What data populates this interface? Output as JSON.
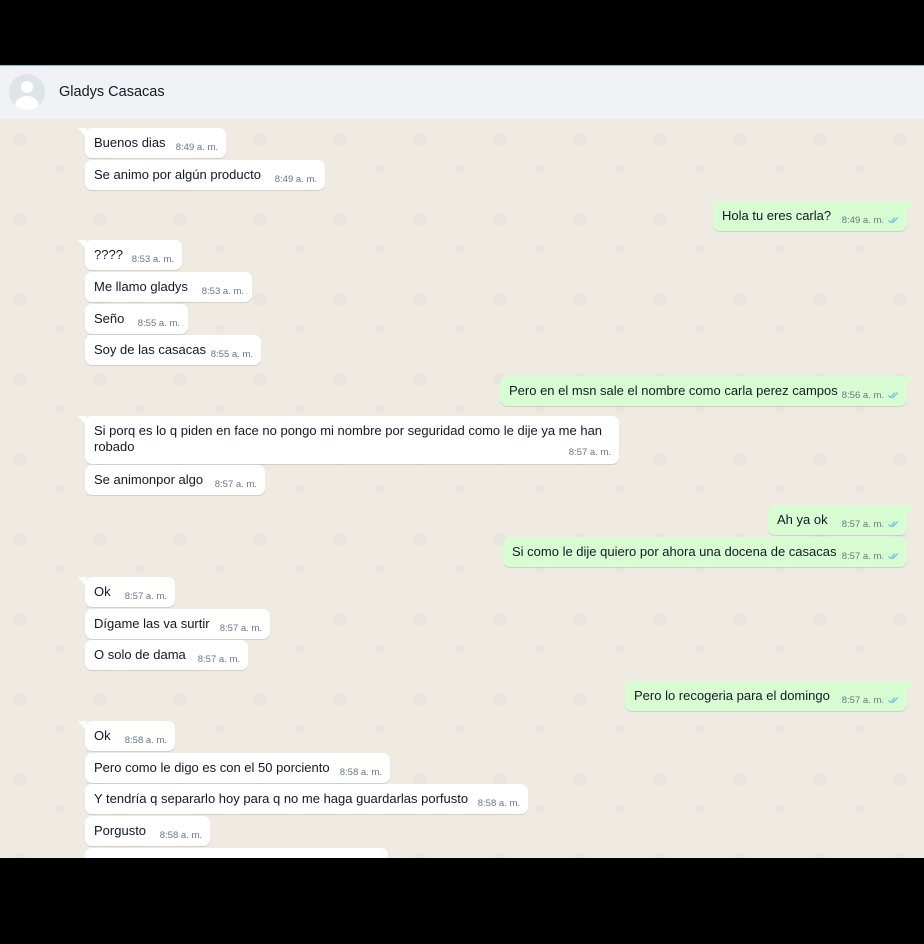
{
  "chat": {
    "contact_name": "Gladys Casacas",
    "messages": [
      {
        "dir": "in",
        "text": "Buenos dias",
        "time": "8:49 a. m."
      },
      {
        "dir": "in",
        "text": "Se animo por algún producto",
        "time": "8:49 a. m."
      },
      {
        "dir": "out",
        "text": "Hola tu eres carla?",
        "time": "8:49 a. m.",
        "status": "read"
      },
      {
        "dir": "in",
        "text": "????",
        "time": "8:53 a. m."
      },
      {
        "dir": "in",
        "text": "Me llamo gladys",
        "time": "8:53 a. m."
      },
      {
        "dir": "in",
        "text": "Seño",
        "time": "8:55 a. m."
      },
      {
        "dir": "in",
        "text": "Soy de las casacas",
        "time": "8:55 a. m."
      },
      {
        "dir": "out",
        "text": "Pero en el msn sale el nombre como carla perez campos",
        "time": "8:56 a. m.",
        "status": "read"
      },
      {
        "dir": "in",
        "text": "Si porq es lo q piden en face no pongo mi nombre por seguridad como le dije ya me han robado",
        "time": "8:57 a. m."
      },
      {
        "dir": "in",
        "text": "Se animonpor algo",
        "time": "8:57 a. m."
      },
      {
        "dir": "out",
        "text": "Ah ya ok",
        "time": "8:57 a. m.",
        "status": "read"
      },
      {
        "dir": "out",
        "text": "Si como le dije quiero por ahora una docena de casacas",
        "time": "8:57 a. m.",
        "status": "read"
      },
      {
        "dir": "in",
        "text": "Ok",
        "time": "8:57 a. m."
      },
      {
        "dir": "in",
        "text": "Dígame las va surtir",
        "time": "8:57 a. m."
      },
      {
        "dir": "in",
        "text": "O solo de dama",
        "time": "8:57 a. m."
      },
      {
        "dir": "out",
        "text": "Pero lo recogeria para el domingo",
        "time": "8:57 a. m.",
        "status": "read"
      },
      {
        "dir": "in",
        "text": "Ok",
        "time": "8:58 a. m."
      },
      {
        "dir": "in",
        "text": "Pero como le digo es con el 50 porciento",
        "time": "8:58 a. m."
      },
      {
        "dir": "in",
        "text": "Y tendría q separarlo hoy para q no me haga  guardarlas porfusto",
        "time": "8:58 a. m."
      },
      {
        "dir": "in",
        "text": "Porgusto",
        "time": "8:58 a. m."
      }
    ]
  },
  "colors": {
    "incoming_bubble": "#ffffff",
    "outgoing_bubble": "#d9fdd3",
    "chat_background": "#efeae2",
    "read_ticks": "#53bdeb"
  }
}
